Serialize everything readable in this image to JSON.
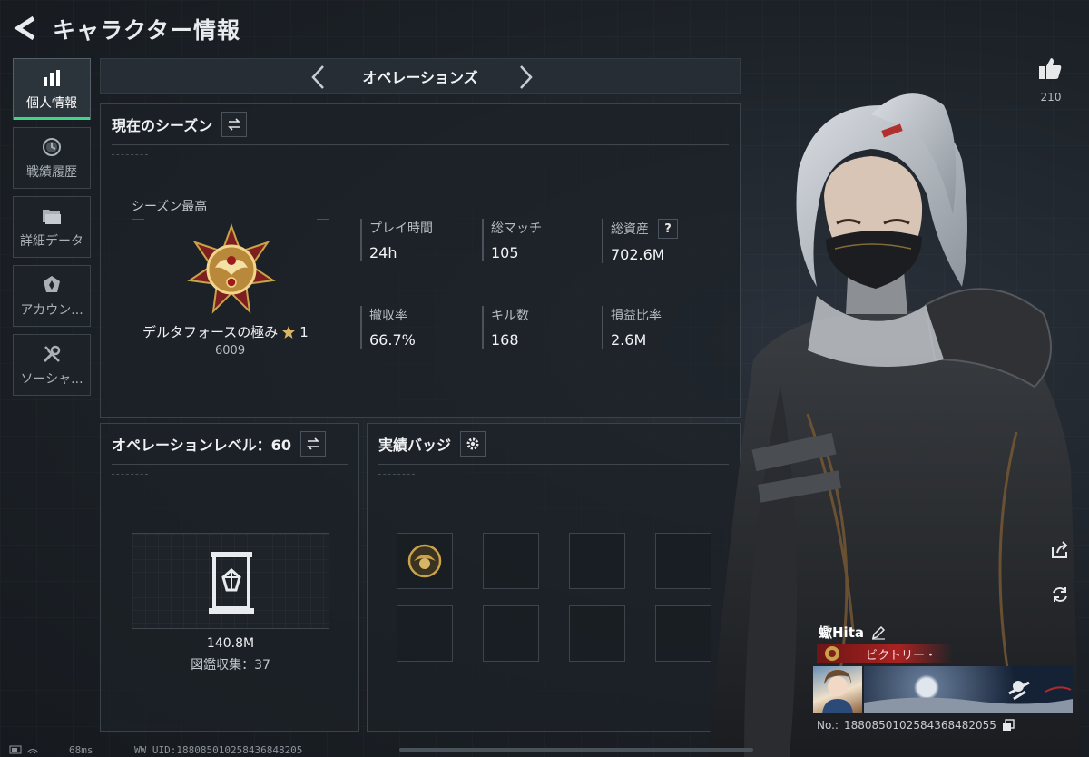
{
  "header": {
    "title": "キャラクター情報"
  },
  "sidebar": {
    "items": [
      {
        "label": "個人情報",
        "icon": "bar-chart-icon",
        "active": true
      },
      {
        "label": "戦績履歴",
        "icon": "history-clock-icon"
      },
      {
        "label": "詳細データ",
        "icon": "folder-icon"
      },
      {
        "label": "アカウン...",
        "icon": "account-emblem-icon"
      },
      {
        "label": "ソーシャ...",
        "icon": "tools-icon"
      }
    ]
  },
  "mode": {
    "label": "オペレーションズ"
  },
  "season": {
    "title": "現在のシーズン",
    "best_label": "シーズン最高",
    "rank_name": "デルタフォースの極み",
    "rank_stars": "1",
    "rank_points": "6009",
    "stats": [
      {
        "label": "プレイ時間",
        "value": "24h"
      },
      {
        "label": "総マッチ",
        "value": "105"
      },
      {
        "label": "総資産",
        "value": "702.6M",
        "help": "?"
      },
      {
        "label": "撤収率",
        "value": "66.7%"
      },
      {
        "label": "キル数",
        "value": "168"
      },
      {
        "label": "損益比率",
        "value": "2.6M"
      }
    ]
  },
  "operation_level": {
    "title": "オペレーションレベル：60",
    "value": "140.8M",
    "collection": "図鑑収集：37"
  },
  "achievements": {
    "title": "実績バッジ",
    "slots": 8,
    "filled": 1
  },
  "likes": {
    "count": "210"
  },
  "profile_card": {
    "name": "蠍Hita",
    "title_banner": "ビクトリー・",
    "no_label": "No.:",
    "no_value": "1880850102584368482055"
  },
  "status": {
    "ping": "68ms",
    "uid": "WW UID:18808501025843684820​5"
  },
  "colors": {
    "accent": "#3fd68a",
    "gold": "#c9a24a",
    "banner": "#8b1a1a"
  }
}
